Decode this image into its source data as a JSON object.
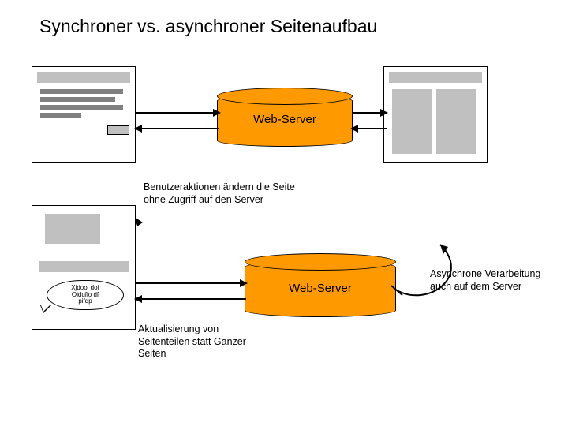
{
  "title": "Synchroner vs. asynchroner Seitenaufbau",
  "server": {
    "label": "Web-Server"
  },
  "notes": {
    "user_actions": "Benutzeraktionen ändern die Seite ohne Zugriff auf den Server",
    "partial_update": "Aktualisierung von Seitenteilen statt Ganzer Seiten",
    "async_server": "Asynchrone Verarbeitung auch auf dem Server"
  },
  "bubble": {
    "line1": "Xjdooi dof",
    "line2": "Oidufio df",
    "line3": "pifdp"
  },
  "chart_data": {
    "type": "diagram",
    "nodes": [
      {
        "id": "browser_full_before",
        "kind": "browser-page",
        "pos": "top-left"
      },
      {
        "id": "browser_full_after",
        "kind": "browser-page",
        "pos": "top-right"
      },
      {
        "id": "web_server_top",
        "kind": "server-cylinder",
        "label": "Web-Server"
      },
      {
        "id": "browser_partial",
        "kind": "browser-page",
        "pos": "bottom-left",
        "tooltip": [
          "Xjdooi dof",
          "Oidufio df",
          "pifdp"
        ]
      },
      {
        "id": "web_server_bottom",
        "kind": "server-cylinder",
        "label": "Web-Server"
      }
    ],
    "edges": [
      {
        "from": "browser_full_before",
        "to": "web_server_top",
        "dir": "both"
      },
      {
        "from": "web_server_top",
        "to": "browser_full_after",
        "dir": "both"
      },
      {
        "from": "browser_partial",
        "to": "browser_partial",
        "dir": "self",
        "label": "Benutzeraktionen ändern die Seite ohne Zugriff auf den Server"
      },
      {
        "from": "browser_partial",
        "to": "web_server_bottom",
        "dir": "both",
        "label": "Aktualisierung von Seitenteilen statt Ganzer Seiten"
      },
      {
        "from": "web_server_bottom",
        "to": "web_server_bottom",
        "dir": "self",
        "label": "Asynchrone Verarbeitung auch auf dem Server"
      }
    ]
  }
}
